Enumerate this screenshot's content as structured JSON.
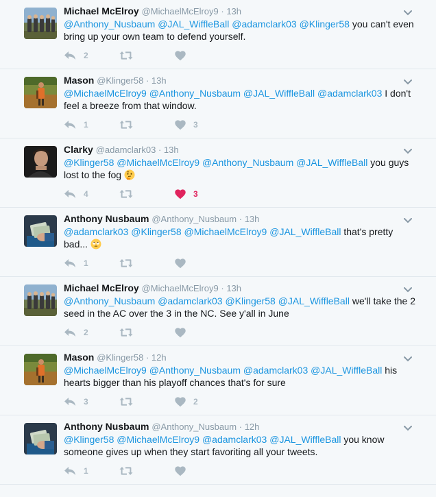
{
  "tweets": [
    {
      "name": "Michael McElroy",
      "handle": "@MichaelMcElroy9",
      "time": "13h",
      "avatar": "group",
      "segments": [
        {
          "t": "@Anthony_Nusbaum",
          "m": true
        },
        {
          "t": " ",
          "m": false
        },
        {
          "t": "@JAL_WiffleBall",
          "m": true
        },
        {
          "t": " ",
          "m": false
        },
        {
          "t": "@adamclark03",
          "m": true
        },
        {
          "t": " ",
          "m": false
        },
        {
          "t": "@Klinger58",
          "m": true
        },
        {
          "t": " you can't even bring up your own team to defend yourself.",
          "m": false
        }
      ],
      "reply_count": "2",
      "retweet_count": "",
      "like_count": "",
      "liked": false
    },
    {
      "name": "Mason",
      "handle": "@Klinger58",
      "time": "13h",
      "avatar": "outdoor",
      "segments": [
        {
          "t": "@MichaelMcElroy9",
          "m": true
        },
        {
          "t": " ",
          "m": false
        },
        {
          "t": "@Anthony_Nusbaum",
          "m": true
        },
        {
          "t": " ",
          "m": false
        },
        {
          "t": "@JAL_WiffleBall",
          "m": true
        },
        {
          "t": " ",
          "m": false
        },
        {
          "t": "@adamclark03",
          "m": true
        },
        {
          "t": " I don't feel a breeze from that window.",
          "m": false
        }
      ],
      "reply_count": "1",
      "retweet_count": "",
      "like_count": "3",
      "liked": false
    },
    {
      "name": "Clarky",
      "handle": "@adamclark03",
      "time": "13h",
      "avatar": "person",
      "segments": [
        {
          "t": "@Klinger58",
          "m": true
        },
        {
          "t": " ",
          "m": false
        },
        {
          "t": "@MichaelMcElroy9",
          "m": true
        },
        {
          "t": " ",
          "m": false
        },
        {
          "t": "@Anthony_Nusbaum",
          "m": true
        },
        {
          "t": " ",
          "m": false
        },
        {
          "t": "@JAL_WiffleBall",
          "m": true
        },
        {
          "t": " you guys lost to the fog ",
          "m": false
        },
        {
          "e": "thinking-face-emoji"
        }
      ],
      "reply_count": "4",
      "retweet_count": "",
      "like_count": "3",
      "liked": true
    },
    {
      "name": "Anthony Nusbaum",
      "handle": "@Anthony_Nusbaum",
      "time": "13h",
      "avatar": "money",
      "segments": [
        {
          "t": "@adamclark03",
          "m": true
        },
        {
          "t": " ",
          "m": false
        },
        {
          "t": "@Klinger58",
          "m": true
        },
        {
          "t": " ",
          "m": false
        },
        {
          "t": "@MichaelMcElroy9",
          "m": true
        },
        {
          "t": " ",
          "m": false
        },
        {
          "t": "@JAL_WiffleBall",
          "m": true
        },
        {
          "t": " that's pretty bad... ",
          "m": false
        },
        {
          "e": "eye-roll-emoji"
        }
      ],
      "reply_count": "1",
      "retweet_count": "",
      "like_count": "",
      "liked": false
    },
    {
      "name": "Michael McElroy",
      "handle": "@MichaelMcElroy9",
      "time": "13h",
      "avatar": "group",
      "segments": [
        {
          "t": "@Anthony_Nusbaum",
          "m": true
        },
        {
          "t": " ",
          "m": false
        },
        {
          "t": "@adamclark03",
          "m": true
        },
        {
          "t": " ",
          "m": false
        },
        {
          "t": "@Klinger58",
          "m": true
        },
        {
          "t": " ",
          "m": false
        },
        {
          "t": "@JAL_WiffleBall",
          "m": true
        },
        {
          "t": " we'll take the 2 seed in the AC over the 3 in the NC. See y'all in June",
          "m": false
        }
      ],
      "reply_count": "2",
      "retweet_count": "",
      "like_count": "",
      "liked": false
    },
    {
      "name": "Mason",
      "handle": "@Klinger58",
      "time": "12h",
      "avatar": "outdoor",
      "segments": [
        {
          "t": "@MichaelMcElroy9",
          "m": true
        },
        {
          "t": " ",
          "m": false
        },
        {
          "t": "@Anthony_Nusbaum",
          "m": true
        },
        {
          "t": " ",
          "m": false
        },
        {
          "t": "@adamclark03",
          "m": true
        },
        {
          "t": " ",
          "m": false
        },
        {
          "t": "@JAL_WiffleBall",
          "m": true
        },
        {
          "t": " his hearts bigger than his playoff chances that's for sure",
          "m": false
        }
      ],
      "reply_count": "3",
      "retweet_count": "",
      "like_count": "2",
      "liked": false
    },
    {
      "name": "Anthony Nusbaum",
      "handle": "@Anthony_Nusbaum",
      "time": "12h",
      "avatar": "money",
      "segments": [
        {
          "t": "@Klinger58",
          "m": true
        },
        {
          "t": " ",
          "m": false
        },
        {
          "t": "@MichaelMcElroy9",
          "m": true
        },
        {
          "t": " ",
          "m": false
        },
        {
          "t": "@adamclark03",
          "m": true
        },
        {
          "t": " ",
          "m": false
        },
        {
          "t": "@JAL_WiffleBall",
          "m": true
        },
        {
          "t": " you know someone gives up when they start favoriting all your tweets.",
          "m": false
        }
      ],
      "reply_count": "1",
      "retweet_count": "",
      "like_count": "",
      "liked": false
    }
  ],
  "colors": {
    "mention": "#1b95e0",
    "meta": "#8899a6",
    "icon": "#aab8c2",
    "liked": "#e0245e",
    "divider": "#e1e8ed"
  },
  "icons": {
    "reply": "reply-icon",
    "retweet": "retweet-icon",
    "like": "heart-icon",
    "menu": "chevron-down-icon"
  }
}
